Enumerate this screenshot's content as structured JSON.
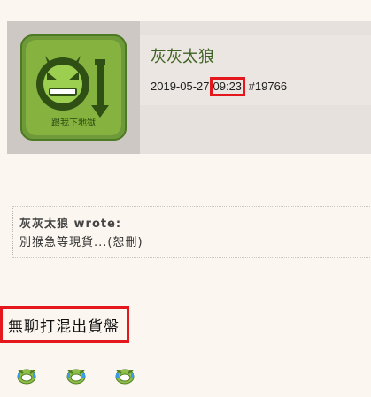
{
  "post": {
    "username": "灰灰太狼",
    "date": "2019-05-27",
    "time": "09:23",
    "post_number": "#19766",
    "avatar_caption": "跟我下地獄"
  },
  "quote": {
    "author_line": "灰灰太狼 wrote:",
    "text": "別猴急等現貨...(恕刪)"
  },
  "body": {
    "text": "無聊打混出貨盤"
  },
  "emojis": [
    "crying-laugh-emoji",
    "crying-laugh-emoji",
    "crying-laugh-emoji"
  ],
  "colors": {
    "highlight": "#e3171c",
    "username": "#3f6324",
    "background": "#fbf6ef"
  }
}
